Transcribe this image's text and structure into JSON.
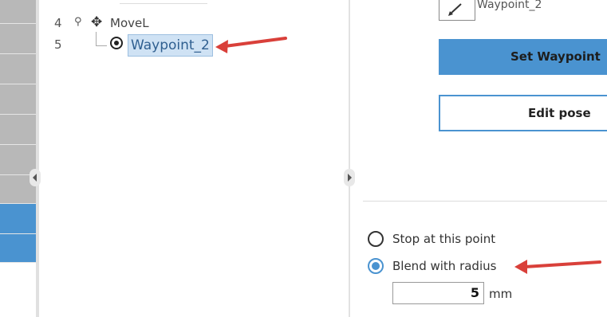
{
  "tree": {
    "rows": [
      {
        "line": "4",
        "label": "MoveL"
      },
      {
        "line": "5",
        "label": "Waypoint_2"
      }
    ]
  },
  "pose": {
    "name": "Waypoint_2",
    "set_waypoint_label": "Set Waypoint",
    "edit_pose_label": "Edit pose"
  },
  "blend": {
    "option_stop": "Stop at this point",
    "option_blend": "Blend with radius",
    "selected": "option_blend",
    "radius_value": "5",
    "radius_unit": "mm"
  },
  "colors": {
    "accent": "#4a93d0",
    "arrow": "#d9403a",
    "selection": "#cfe2f4"
  }
}
